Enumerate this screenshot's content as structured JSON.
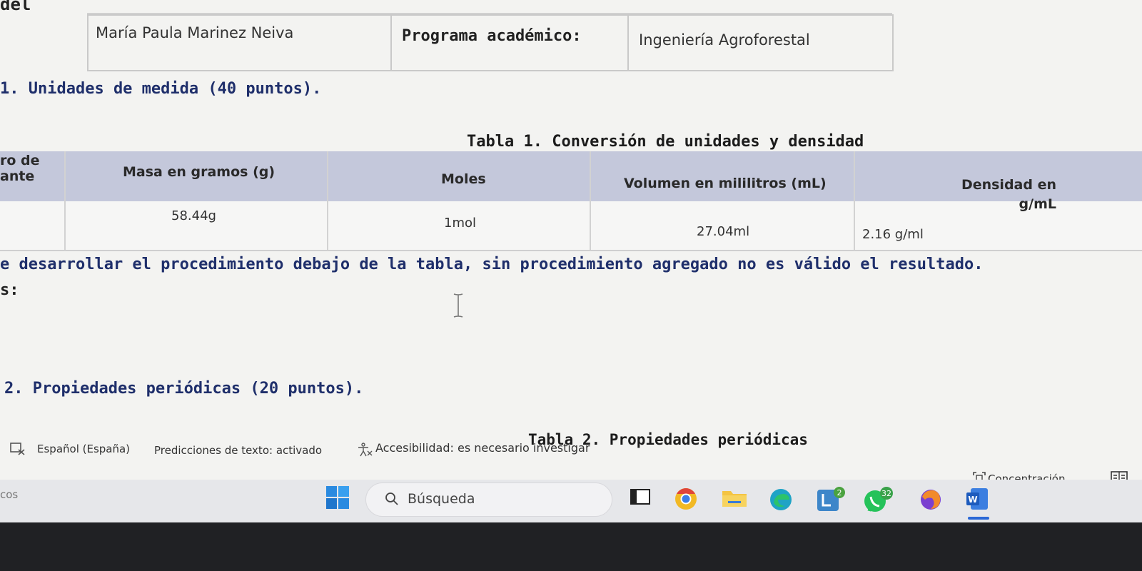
{
  "header": {
    "left_fragment": "del",
    "student_name": "María Paula Marinez Neiva",
    "program_label": "Programa académico:",
    "program_value": "Ingeniería Agroforestal"
  },
  "section1": {
    "title": "1. Unidades de medida (40 puntos)."
  },
  "table1": {
    "caption": "Tabla 1. Conversión de unidades y densidad",
    "col0_header": "ro de\nante",
    "headers": [
      "Masa en gramos (g)",
      "Moles",
      "Volumen en mililitros (mL)",
      "Densidad en g/mL"
    ],
    "row": [
      "58.44g",
      "1mol",
      "27.04ml",
      "2.16 g/ml"
    ]
  },
  "note": "e desarrollar el procedimiento debajo de la tabla, sin procedimiento agregado no es válido el resultado.",
  "answer_label": "s:",
  "section2": {
    "title": "2. Propiedades periódicas (20 puntos)."
  },
  "table2": {
    "caption": "Tabla 2. Propiedades periódicas"
  },
  "statusbar": {
    "language": "Español (España)",
    "predictions": "Predicciones de texto: activado",
    "accessibility": "Accesibilidad: es necesario investigar",
    "focus": "Concentración"
  },
  "taskbar": {
    "left_fragment": "cos",
    "search_placeholder": "Búsqueda",
    "badge_1": "2",
    "badge_2": "32"
  }
}
